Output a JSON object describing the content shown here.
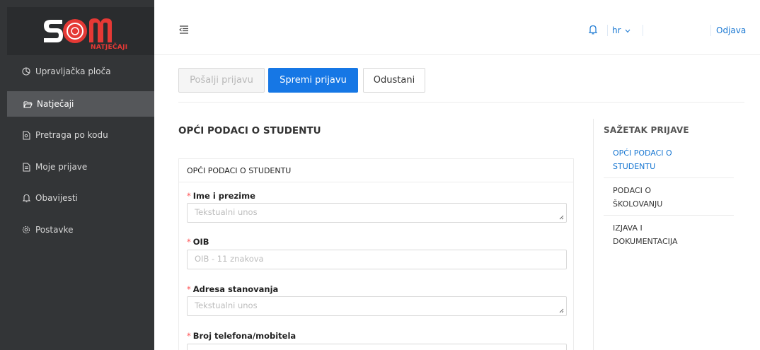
{
  "sidebar": {
    "logo_text": "SOM",
    "logo_sub": "NATJEČAJI",
    "items": [
      {
        "label": "Upravljačka ploča",
        "icon": "dashboard-icon"
      },
      {
        "label": "Natječaji",
        "icon": "folder-open-icon"
      },
      {
        "label": "Pretraga po kodu",
        "icon": "document-search-icon"
      },
      {
        "label": "Moje prijave",
        "icon": "document-icon"
      },
      {
        "label": "Obavijesti",
        "icon": "bell-icon"
      },
      {
        "label": "Postavke",
        "icon": "gear-icon"
      }
    ],
    "active_index": 1
  },
  "header": {
    "language": "hr",
    "logout": "Odjava"
  },
  "actions": {
    "send": "Pošalji prijavu",
    "save": "Spremi prijavu",
    "cancel": "Odustani"
  },
  "main": {
    "section_title": "OPĆI PODACI O STUDENTU",
    "card_title": "OPĆI PODACI O STUDENTU",
    "fields": [
      {
        "label": "Ime i prezime",
        "placeholder": "Tekstualni unos",
        "required": true
      },
      {
        "label": "OIB",
        "placeholder": "OIB - 11 znakova",
        "required": true
      },
      {
        "label": "Adresa stanovanja",
        "placeholder": "Tekstualni unos",
        "required": true
      },
      {
        "label": "Broj telefona/mobitela",
        "placeholder": "",
        "required": true
      }
    ]
  },
  "summary": {
    "title": "SAŽETAK PRIJAVE",
    "items": [
      {
        "line1": "OPĆI PODACI O",
        "line2": "STUDENTU"
      },
      {
        "line1": "PODACI O",
        "line2": "ŠKOLOVANJU"
      },
      {
        "line1": "IZJAVA I",
        "line2": "DOKUMENTACIJA"
      }
    ]
  },
  "colors": {
    "sidebar_bg": "#333537",
    "primary": "#1677e5",
    "link": "#1877d2",
    "required": "#ff4d4f",
    "brand_red": "#e53935"
  }
}
